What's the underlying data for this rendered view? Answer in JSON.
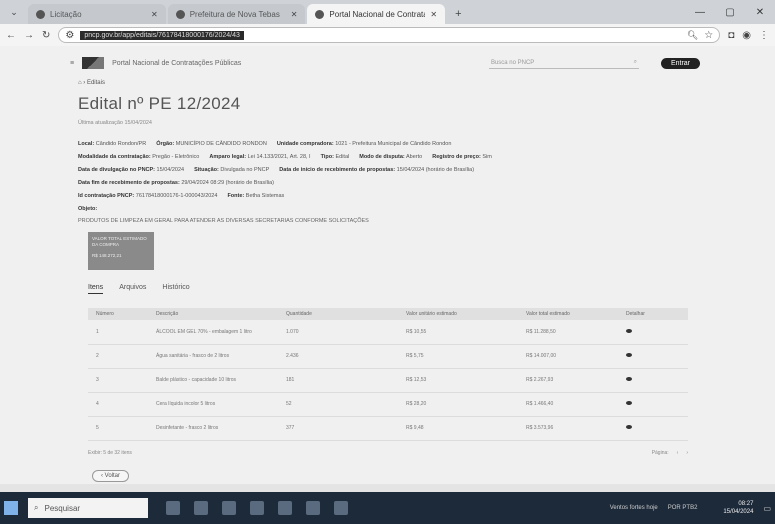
{
  "browser": {
    "tabs": [
      {
        "label": "Licitação",
        "active": false
      },
      {
        "label": "Prefeitura de Nova Tebas",
        "active": false
      },
      {
        "label": "Portal Nacional de Contratação",
        "active": true
      }
    ],
    "url": "pncp.gov.br/app/editais/76178418000176/2024/43"
  },
  "site": {
    "name": "Portal Nacional de Contratações Públicas",
    "search_placeholder": "Busca no PNCP",
    "login_label": "Entrar"
  },
  "breadcrumb": "Editais",
  "edital": {
    "title": "Edital nº PE 12/2024",
    "updated": "Última atualização 15/04/2024",
    "local": {
      "label": "Local:",
      "value": "Cândido Rondon/PR"
    },
    "orgao": {
      "label": "Órgão:",
      "value": "MUNICÍPIO DE CÂNDIDO RONDON"
    },
    "unidade": {
      "label": "Unidade compradora:",
      "value": "1021 - Prefeitura Municipal de Cândido Rondon"
    },
    "modalidade": {
      "label": "Modalidade da contratação:",
      "value": "Pregão - Eletrônico"
    },
    "amparo": {
      "label": "Amparo legal:",
      "value": "Lei 14.133/2021, Art. 28, I"
    },
    "tipo": {
      "label": "Tipo:",
      "value": "Edital"
    },
    "modo": {
      "label": "Modo de disputa:",
      "value": "Aberto"
    },
    "registro": {
      "label": "Registro de preço:",
      "value": "Sim"
    },
    "divulgacao": {
      "label": "Data de divulgação no PNCP:",
      "value": "15/04/2024"
    },
    "situacao": {
      "label": "Situação:",
      "value": "Divulgada no PNCP"
    },
    "inicio": {
      "label": "Data de início de recebimento de propostas:",
      "value": "15/04/2024 (horário de Brasília)"
    },
    "fim": {
      "label": "Data fim de recebimento de propostas:",
      "value": "29/04/2024 08:29 (horário de Brasília)"
    },
    "id_pncp": {
      "label": "Id contratação PNCP:",
      "value": "76178418000176-1-000043/2024"
    },
    "fonte": {
      "label": "Fonte:",
      "value": "Betha Sistemas"
    },
    "objeto_label": "Objeto:",
    "objeto": "PRODUTOS DE LIMPEZA EM GERAL PARA ATENDER AS DIVERSAS SECRETARIAS CONFORME SOLICITAÇÕES",
    "valor_label": "VALOR TOTAL ESTIMADO DA COMPRA",
    "valor": "R$ 148.272,21"
  },
  "content_tabs": [
    "Itens",
    "Arquivos",
    "Histórico"
  ],
  "table": {
    "headers": [
      "Número",
      "Descrição",
      "Quantidade",
      "Valor unitário estimado",
      "Valor total estimado",
      "Detalhar"
    ],
    "rows": [
      {
        "n": "1",
        "desc": "ÁLCOOL EM GEL 70% - embalagem 1 litro",
        "qtd": "1.070",
        "vu": "R$ 10,55",
        "vt": "R$ 11.288,50"
      },
      {
        "n": "2",
        "desc": "Água sanitária - frasco de 2 litros",
        "qtd": "2.436",
        "vu": "R$ 5,75",
        "vt": "R$ 14.007,00"
      },
      {
        "n": "3",
        "desc": "Balde plástico - capacidade 10 litros",
        "qtd": "181",
        "vu": "R$ 12,53",
        "vt": "R$ 2.267,93"
      },
      {
        "n": "4",
        "desc": "Cera líquida incolor 5 litros",
        "qtd": "52",
        "vu": "R$ 28,20",
        "vt": "R$ 1.466,40"
      },
      {
        "n": "5",
        "desc": "Desinfetante - frasco 2 litros",
        "qtd": "377",
        "vu": "R$ 9,48",
        "vt": "R$ 3.573,96"
      }
    ],
    "footer": "Exibir: 5 de 32 itens",
    "page_label": "Página:",
    "prev": "‹",
    "next": "›"
  },
  "back_label": "‹ Voltar",
  "taskbar": {
    "search": "Pesquisar",
    "weather": "Ventos fortes hoje",
    "lang": "POR PTB2",
    "time": "08:27",
    "date": "15/04/2024"
  }
}
